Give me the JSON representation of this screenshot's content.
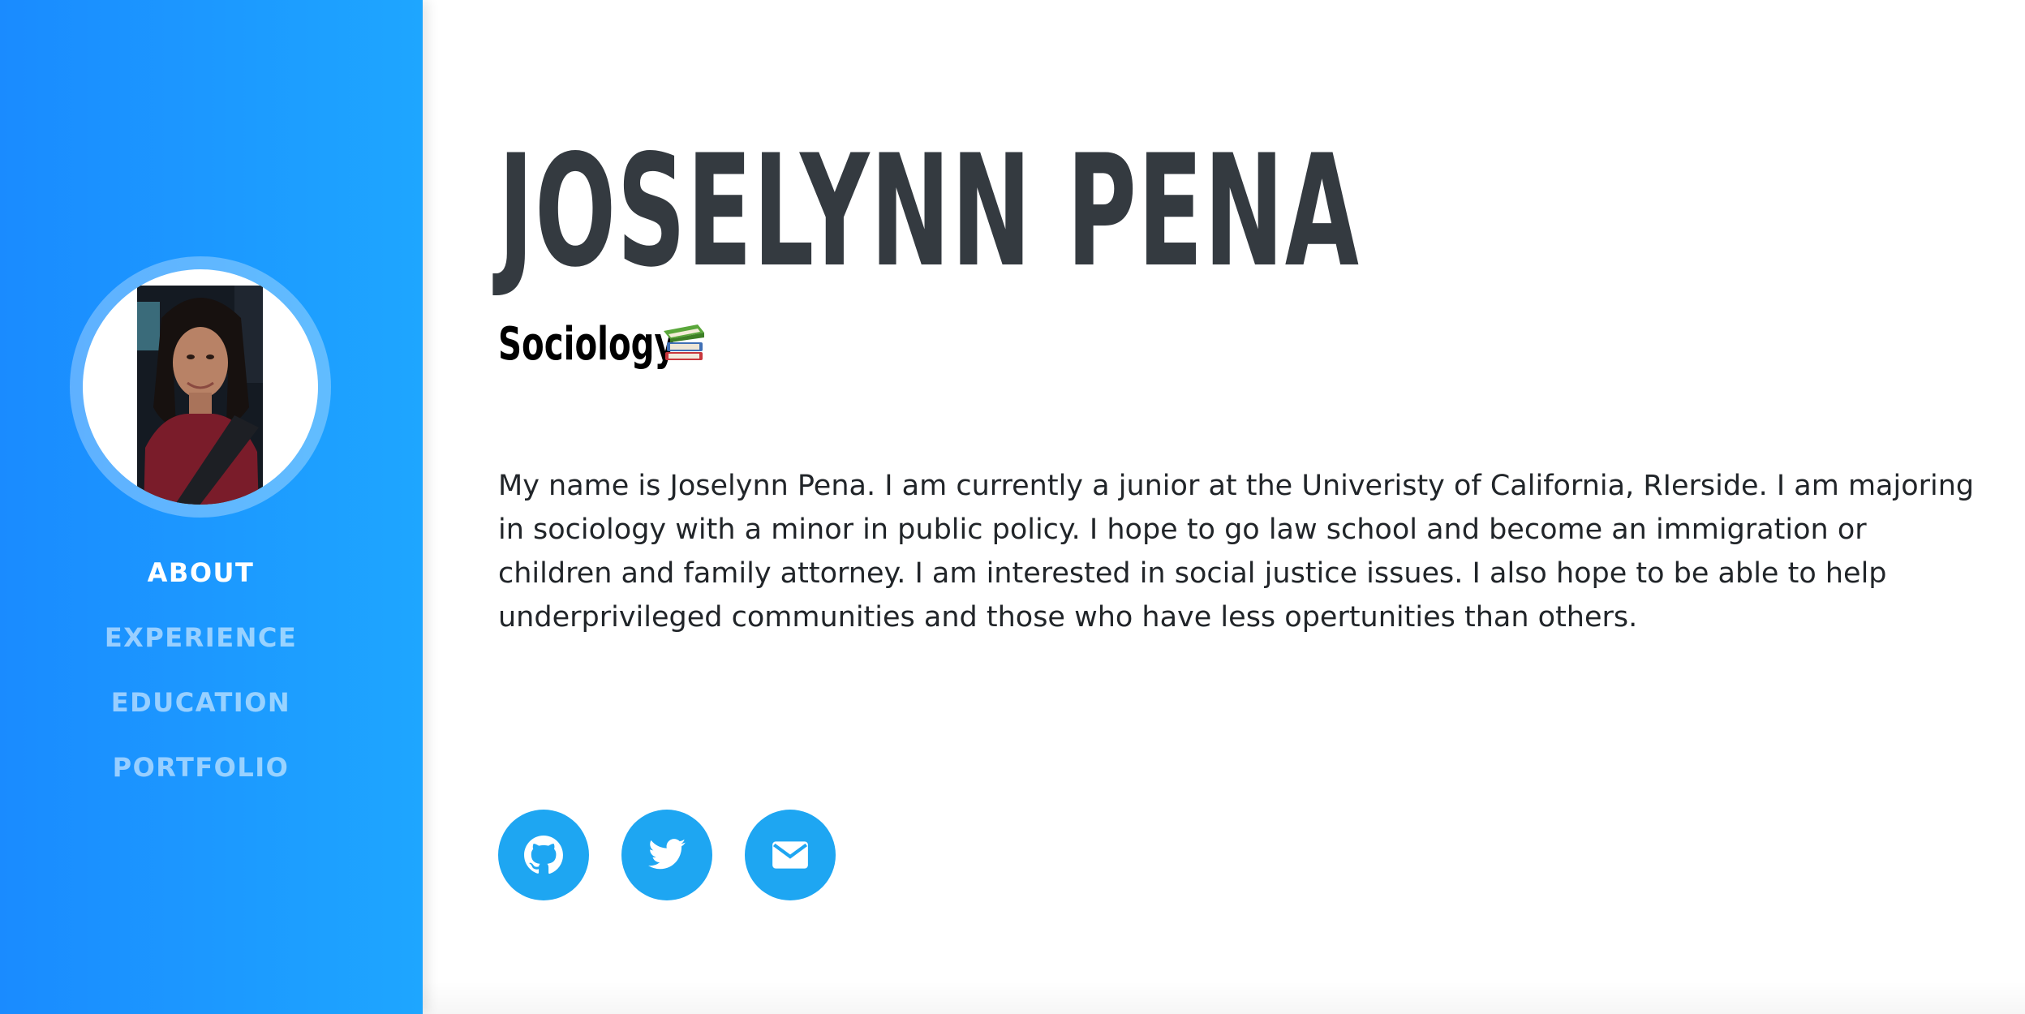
{
  "sidebar": {
    "avatar_alt": "Profile photo",
    "nav": [
      {
        "label": "ABOUT",
        "active": true
      },
      {
        "label": "EXPERIENCE",
        "active": false
      },
      {
        "label": "EDUCATION",
        "active": false
      },
      {
        "label": "PORTFOLIO",
        "active": false
      }
    ],
    "gradient_start": "#1a8bff",
    "gradient_end": "#1ea6ff"
  },
  "main": {
    "name": "JOSELYNN PENA",
    "subtitle": "Sociology",
    "subtitle_icon": "books-emoji-icon",
    "bio": "My name is Joselynn Pena. I am currently a junior at the Univeristy of California, RIerside. I am majoring in sociology with a minor in public policy. I hope to go law school and become an immigration or children and family attorney. I am interested in social justice issues. I also hope to be able to help underprivileged communities and those who have less opertunities than others.",
    "socials": [
      {
        "name": "github-icon"
      },
      {
        "name": "twitter-icon"
      },
      {
        "name": "email-icon"
      }
    ],
    "accent_color": "#1ea6f2",
    "heading_color": "#343a40"
  }
}
